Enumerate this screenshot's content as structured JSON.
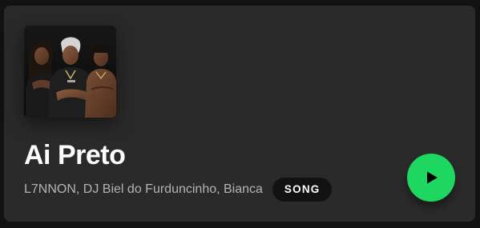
{
  "card": {
    "title": "Ai Preto",
    "artists": "L7NNON, DJ Biel do Furduncinho, Bianca",
    "badge": "SONG",
    "cover_icon": "album-cover-image",
    "play_icon": "play-icon"
  },
  "colors": {
    "page_background": "#121212",
    "card_background": "#2a2a2a",
    "accent": "#1ed760",
    "secondary_text": "#b3b3b3",
    "badge_background": "#121212"
  }
}
